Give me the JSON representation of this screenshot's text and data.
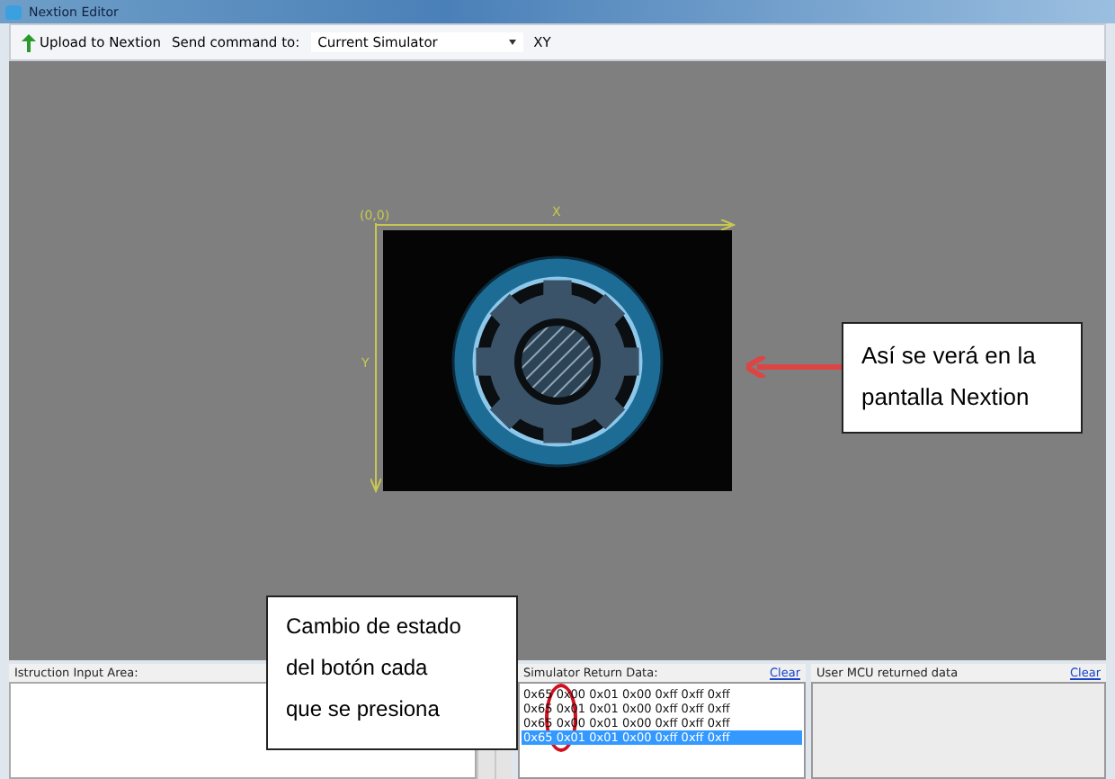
{
  "window": {
    "title": "Nextion Editor"
  },
  "toolbar": {
    "upload_button": "Upload to Nextion",
    "send_label": "Send command to:",
    "target_select": "Current Simulator",
    "xy_label": "XY"
  },
  "canvas": {
    "origin_label": "(0,0)",
    "x_axis_label": "X",
    "y_axis_label": "Y"
  },
  "callouts": [
    "Así se verá en la pantalla Nextion",
    "Cambio de estado del botón cada que se presiona"
  ],
  "instruction_panel": {
    "title": "Istruction Input Area:"
  },
  "simulator_panel": {
    "title": "Simulator Return Data:",
    "clear": "Clear",
    "rows": [
      {
        "text": "0x65 0x00 0x01 0x00 0xff 0xff 0xff",
        "selected": false
      },
      {
        "text": "0x65 0x01 0x01 0x00 0xff 0xff 0xff",
        "selected": false
      },
      {
        "text": "0x65 0x00 0x01 0x00 0xff 0xff 0xff",
        "selected": false
      },
      {
        "text": "0x65 0x01 0x01 0x00 0xff 0xff 0xff",
        "selected": true
      }
    ]
  },
  "mcu_panel": {
    "title": "User MCU returned data",
    "clear": "Clear"
  }
}
